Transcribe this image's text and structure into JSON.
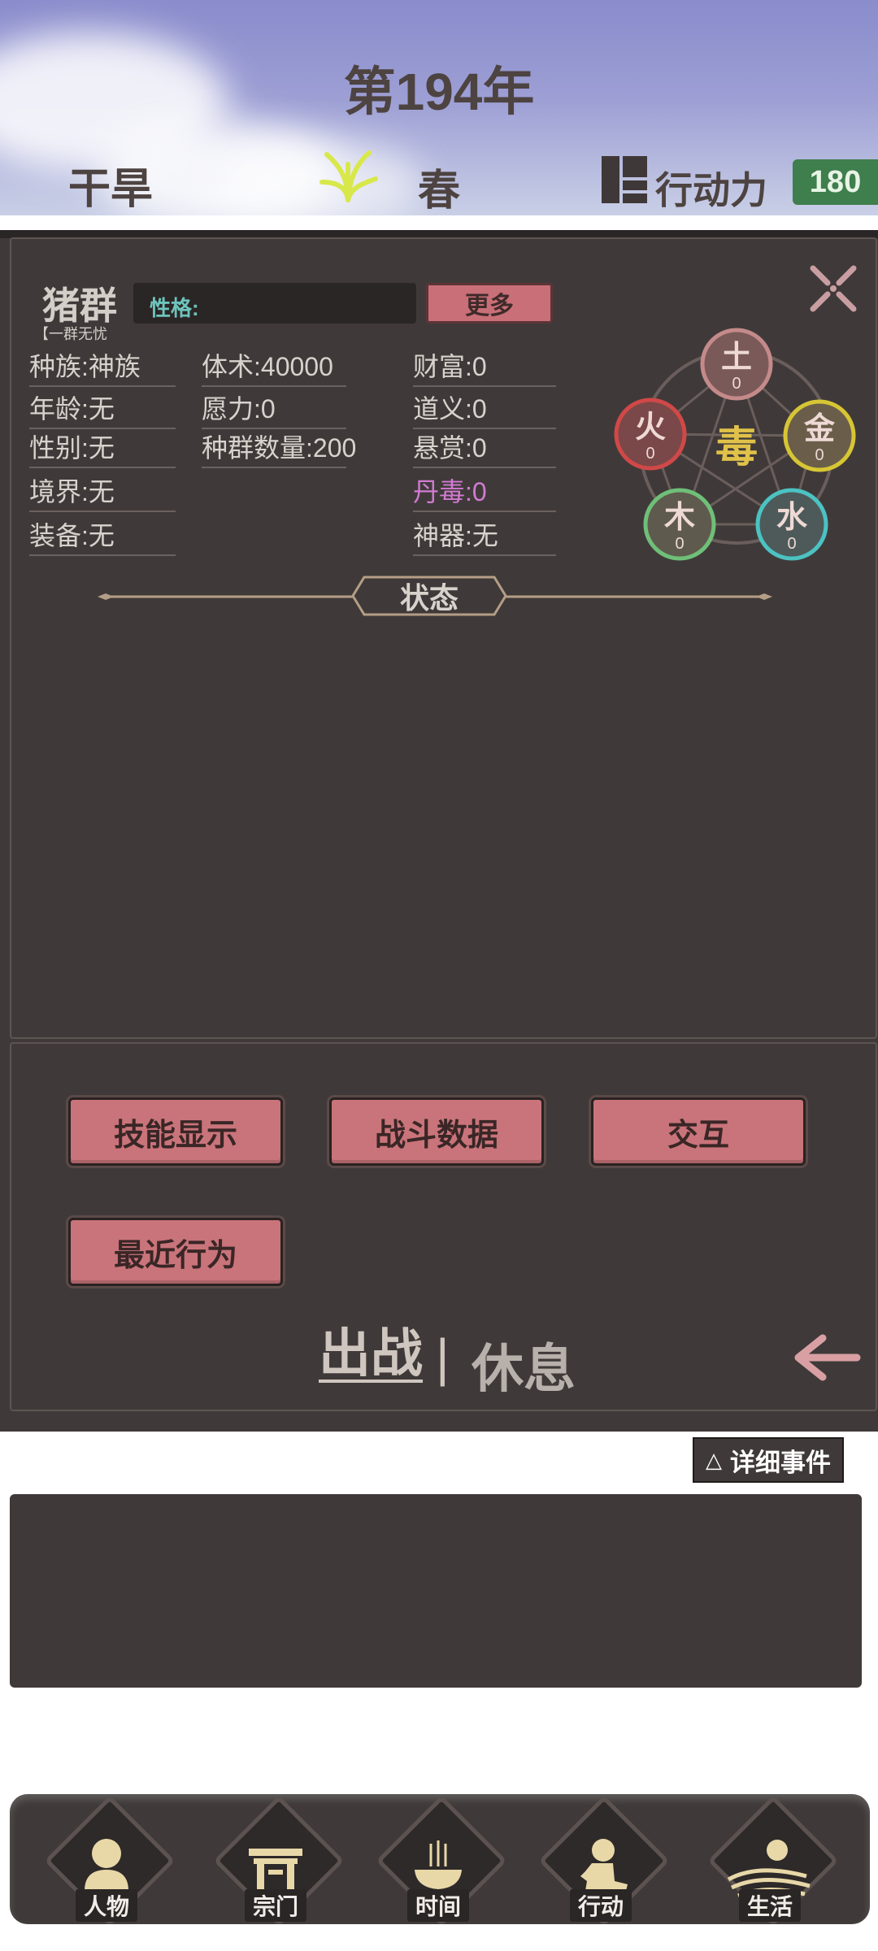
{
  "header": {
    "year": "第194年",
    "weather": "干旱",
    "season": "春",
    "action_power_label": "行动力",
    "action_power_value": "180"
  },
  "character": {
    "name": "猪群",
    "tagline": "【一群无忧",
    "personality_label": "性格:",
    "more_button": "更多",
    "stats_col1": [
      "种族:神族",
      "年龄:无",
      "性别:无",
      "境界:无",
      "装备:无"
    ],
    "stats_col2": [
      "体术:40000",
      "愿力:0",
      "种群数量:200"
    ],
    "stats_col3": [
      "财富:0",
      "道义:0",
      "悬赏:0",
      "丹毒:0",
      "神器:无"
    ]
  },
  "elements": {
    "center": "毒",
    "earth": {
      "label": "土",
      "value": "0"
    },
    "fire": {
      "label": "火",
      "value": "0"
    },
    "metal": {
      "label": "金",
      "value": "0"
    },
    "wood": {
      "label": "木",
      "value": "0"
    },
    "water": {
      "label": "水",
      "value": "0"
    }
  },
  "status_section": "状态",
  "actions": {
    "skills": "技能显示",
    "battle_data": "战斗数据",
    "interact": "交互",
    "recent": "最近行为"
  },
  "toggle": {
    "deploy": "出战",
    "separator": "|",
    "rest": "休息"
  },
  "detail_events": "详细事件",
  "nav": [
    "人物",
    "宗门",
    "时间",
    "行动",
    "生活"
  ],
  "colors": {
    "panel": "#3f3a39",
    "button": "#c9747a",
    "action_power_bg": "#3f7e4d",
    "poison": "#d27ad2",
    "element_center": "#e0c24a"
  }
}
